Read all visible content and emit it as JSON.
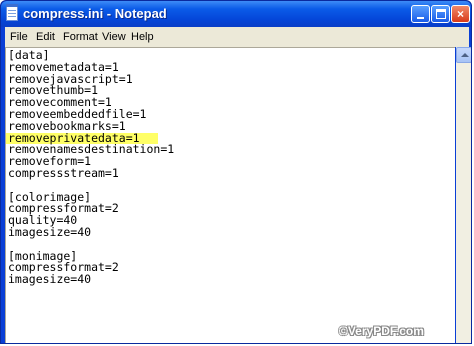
{
  "window": {
    "title": "compress.ini - Notepad",
    "controls": {
      "minimize_icon": "minimize-icon",
      "maximize_icon": "maximize-icon",
      "close_label": "×"
    }
  },
  "menu": {
    "file": "File",
    "edit": "Edit",
    "format": "Format",
    "view": "View",
    "help": "Help"
  },
  "editor": {
    "lines": [
      "[data]",
      "removemetadata=1",
      "removejavascript=1",
      "removethumb=1",
      "removecomment=1",
      "removeembeddedfile=1",
      "removebookmarks=1",
      "removeprivatedata=1",
      "removenamesdestination=1",
      "removeform=1",
      "compressstream=1",
      "",
      "[colorimage]",
      "compressformat=2",
      "quality=40",
      "imagesize=40",
      "",
      "[monimage]",
      "compressformat=2",
      "imagesize=40"
    ],
    "highlighted_line_index": 7,
    "highlight_color": "#ffff66"
  },
  "watermark": "©VeryPDF.com"
}
